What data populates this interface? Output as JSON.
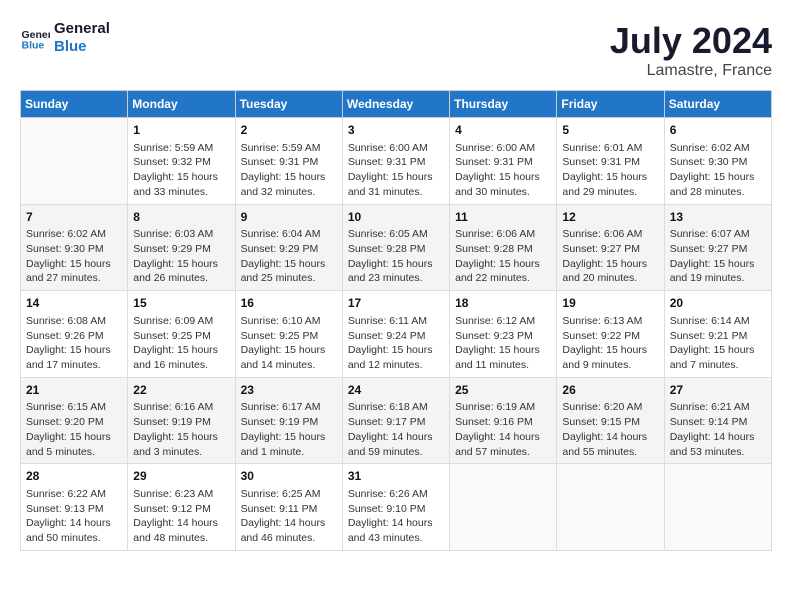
{
  "logo": {
    "line1": "General",
    "line2": "Blue"
  },
  "title": "July 2024",
  "subtitle": "Lamastre, France",
  "headers": [
    "Sunday",
    "Monday",
    "Tuesday",
    "Wednesday",
    "Thursday",
    "Friday",
    "Saturday"
  ],
  "weeks": [
    [
      {
        "day": "",
        "info": ""
      },
      {
        "day": "1",
        "info": "Sunrise: 5:59 AM\nSunset: 9:32 PM\nDaylight: 15 hours\nand 33 minutes."
      },
      {
        "day": "2",
        "info": "Sunrise: 5:59 AM\nSunset: 9:31 PM\nDaylight: 15 hours\nand 32 minutes."
      },
      {
        "day": "3",
        "info": "Sunrise: 6:00 AM\nSunset: 9:31 PM\nDaylight: 15 hours\nand 31 minutes."
      },
      {
        "day": "4",
        "info": "Sunrise: 6:00 AM\nSunset: 9:31 PM\nDaylight: 15 hours\nand 30 minutes."
      },
      {
        "day": "5",
        "info": "Sunrise: 6:01 AM\nSunset: 9:31 PM\nDaylight: 15 hours\nand 29 minutes."
      },
      {
        "day": "6",
        "info": "Sunrise: 6:02 AM\nSunset: 9:30 PM\nDaylight: 15 hours\nand 28 minutes."
      }
    ],
    [
      {
        "day": "7",
        "info": "Sunrise: 6:02 AM\nSunset: 9:30 PM\nDaylight: 15 hours\nand 27 minutes."
      },
      {
        "day": "8",
        "info": "Sunrise: 6:03 AM\nSunset: 9:29 PM\nDaylight: 15 hours\nand 26 minutes."
      },
      {
        "day": "9",
        "info": "Sunrise: 6:04 AM\nSunset: 9:29 PM\nDaylight: 15 hours\nand 25 minutes."
      },
      {
        "day": "10",
        "info": "Sunrise: 6:05 AM\nSunset: 9:28 PM\nDaylight: 15 hours\nand 23 minutes."
      },
      {
        "day": "11",
        "info": "Sunrise: 6:06 AM\nSunset: 9:28 PM\nDaylight: 15 hours\nand 22 minutes."
      },
      {
        "day": "12",
        "info": "Sunrise: 6:06 AM\nSunset: 9:27 PM\nDaylight: 15 hours\nand 20 minutes."
      },
      {
        "day": "13",
        "info": "Sunrise: 6:07 AM\nSunset: 9:27 PM\nDaylight: 15 hours\nand 19 minutes."
      }
    ],
    [
      {
        "day": "14",
        "info": "Sunrise: 6:08 AM\nSunset: 9:26 PM\nDaylight: 15 hours\nand 17 minutes."
      },
      {
        "day": "15",
        "info": "Sunrise: 6:09 AM\nSunset: 9:25 PM\nDaylight: 15 hours\nand 16 minutes."
      },
      {
        "day": "16",
        "info": "Sunrise: 6:10 AM\nSunset: 9:25 PM\nDaylight: 15 hours\nand 14 minutes."
      },
      {
        "day": "17",
        "info": "Sunrise: 6:11 AM\nSunset: 9:24 PM\nDaylight: 15 hours\nand 12 minutes."
      },
      {
        "day": "18",
        "info": "Sunrise: 6:12 AM\nSunset: 9:23 PM\nDaylight: 15 hours\nand 11 minutes."
      },
      {
        "day": "19",
        "info": "Sunrise: 6:13 AM\nSunset: 9:22 PM\nDaylight: 15 hours\nand 9 minutes."
      },
      {
        "day": "20",
        "info": "Sunrise: 6:14 AM\nSunset: 9:21 PM\nDaylight: 15 hours\nand 7 minutes."
      }
    ],
    [
      {
        "day": "21",
        "info": "Sunrise: 6:15 AM\nSunset: 9:20 PM\nDaylight: 15 hours\nand 5 minutes."
      },
      {
        "day": "22",
        "info": "Sunrise: 6:16 AM\nSunset: 9:19 PM\nDaylight: 15 hours\nand 3 minutes."
      },
      {
        "day": "23",
        "info": "Sunrise: 6:17 AM\nSunset: 9:19 PM\nDaylight: 15 hours\nand 1 minute."
      },
      {
        "day": "24",
        "info": "Sunrise: 6:18 AM\nSunset: 9:17 PM\nDaylight: 14 hours\nand 59 minutes."
      },
      {
        "day": "25",
        "info": "Sunrise: 6:19 AM\nSunset: 9:16 PM\nDaylight: 14 hours\nand 57 minutes."
      },
      {
        "day": "26",
        "info": "Sunrise: 6:20 AM\nSunset: 9:15 PM\nDaylight: 14 hours\nand 55 minutes."
      },
      {
        "day": "27",
        "info": "Sunrise: 6:21 AM\nSunset: 9:14 PM\nDaylight: 14 hours\nand 53 minutes."
      }
    ],
    [
      {
        "day": "28",
        "info": "Sunrise: 6:22 AM\nSunset: 9:13 PM\nDaylight: 14 hours\nand 50 minutes."
      },
      {
        "day": "29",
        "info": "Sunrise: 6:23 AM\nSunset: 9:12 PM\nDaylight: 14 hours\nand 48 minutes."
      },
      {
        "day": "30",
        "info": "Sunrise: 6:25 AM\nSunset: 9:11 PM\nDaylight: 14 hours\nand 46 minutes."
      },
      {
        "day": "31",
        "info": "Sunrise: 6:26 AM\nSunset: 9:10 PM\nDaylight: 14 hours\nand 43 minutes."
      },
      {
        "day": "",
        "info": ""
      },
      {
        "day": "",
        "info": ""
      },
      {
        "day": "",
        "info": ""
      }
    ]
  ]
}
